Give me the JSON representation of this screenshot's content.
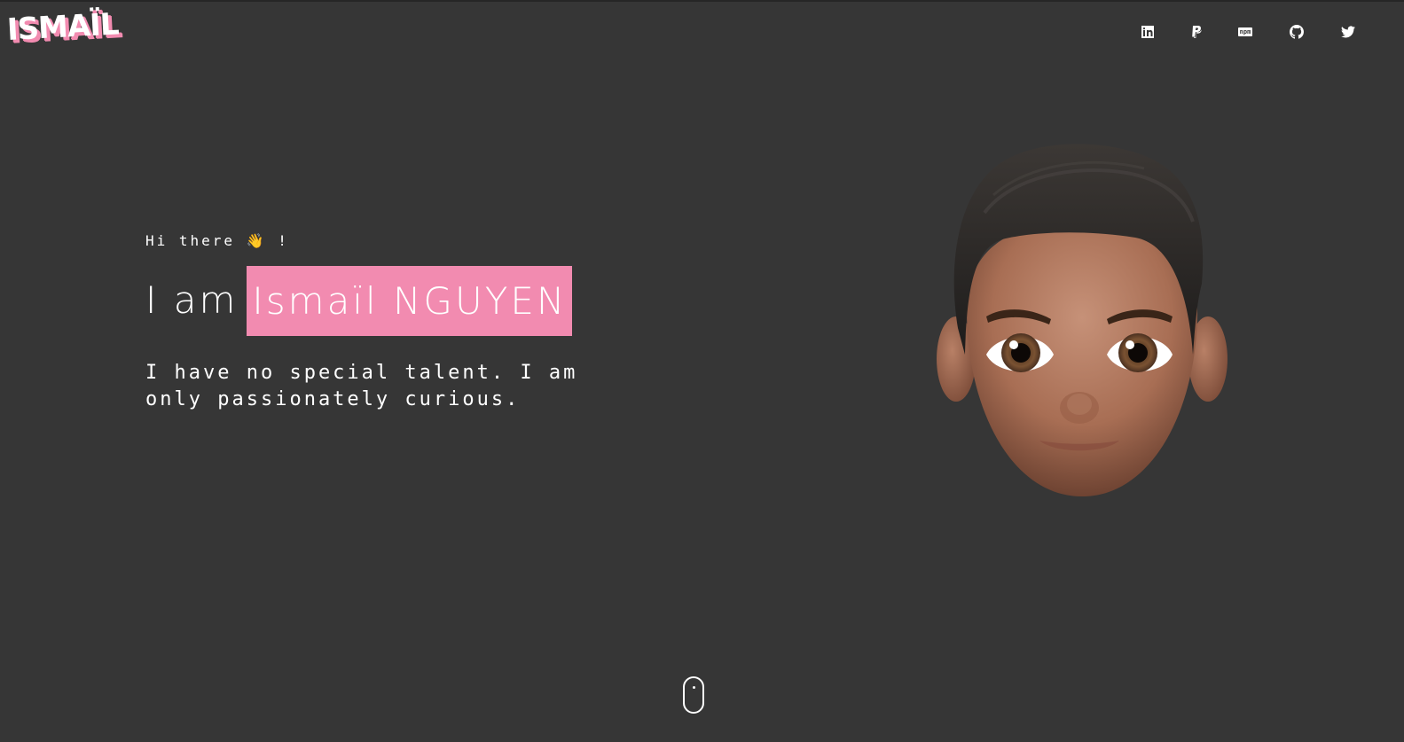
{
  "logo": {
    "text": "ISMAÏL"
  },
  "social": [
    {
      "name": "linkedin-icon"
    },
    {
      "name": "paypal-icon"
    },
    {
      "name": "npm-icon",
      "text": "npm"
    },
    {
      "name": "github-icon"
    },
    {
      "name": "twitter-icon"
    }
  ],
  "hero": {
    "greeting": "Hi there 👋 !",
    "intro_prefix": "I am",
    "name": "Ismaïl NGUYEN",
    "bio": "I have no special talent. I am only passionately curious."
  },
  "colors": {
    "background": "#363636",
    "accent": "#f28bb0",
    "text": "#ffffff"
  }
}
